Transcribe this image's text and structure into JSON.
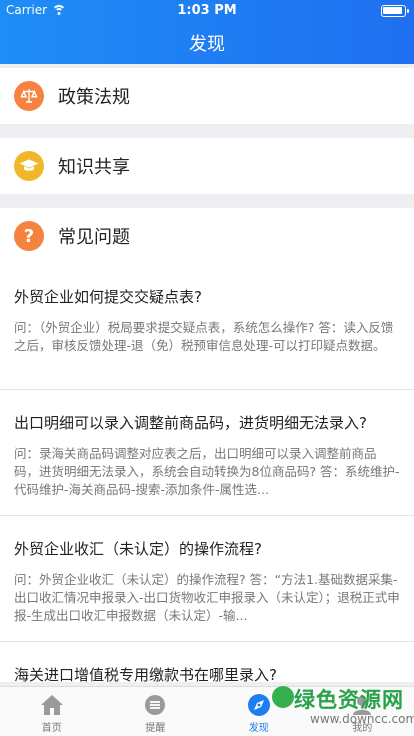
{
  "status": {
    "carrier": "Carrier",
    "time": "1:03 PM"
  },
  "header": {
    "title": "发现"
  },
  "sections": [
    {
      "label": "政策法规",
      "icon": "scale-icon",
      "color": "#f5823f"
    },
    {
      "label": "知识共享",
      "icon": "graduation-cap-icon",
      "color": "#f1b72b"
    },
    {
      "label": "常见问题",
      "icon": "question-icon",
      "color": "#f5823f"
    }
  ],
  "faq": [
    {
      "q": "外贸企业如何提交交疑点表?",
      "a": "问：（外贸企业）税局要求提交疑点表，系统怎么操作? 答：读入反馈之后，审核反馈处理-退（免）税预审信息处理-可以打印疑点数据。"
    },
    {
      "q": "出口明细可以录入调整前商品码，进货明细无法录入?",
      "a": "问：录海关商品码调整对应表之后，出口明细可以录入调整前商品码，进货明细无法录入，系统会自动转换为8位商品码? 答：系统维护-代码维护-海关商品码-搜索-添加条件-属性选..."
    },
    {
      "q": "外贸企业收汇（未认定）的操作流程?",
      "a": "问：外贸企业收汇（未认定）的操作流程? 答：“方法1.基础数据采集-出口收汇情况申报录入-出口货物收汇申报录入（未认定）；退税正式申报-生成出口收汇申报数据（未认定）-输..."
    },
    {
      "q": "海关进口增值税专用缴款书在哪里录入?",
      "a": ""
    }
  ],
  "tabs": [
    {
      "label": "首页",
      "icon": "home-icon"
    },
    {
      "label": "提醒",
      "icon": "reminder-icon"
    },
    {
      "label": "发现",
      "icon": "discover-icon",
      "active": true
    },
    {
      "label": "我的",
      "icon": "profile-icon"
    }
  ],
  "watermark": {
    "main": "绿色资源网",
    "sub": "www.downcc.com"
  }
}
